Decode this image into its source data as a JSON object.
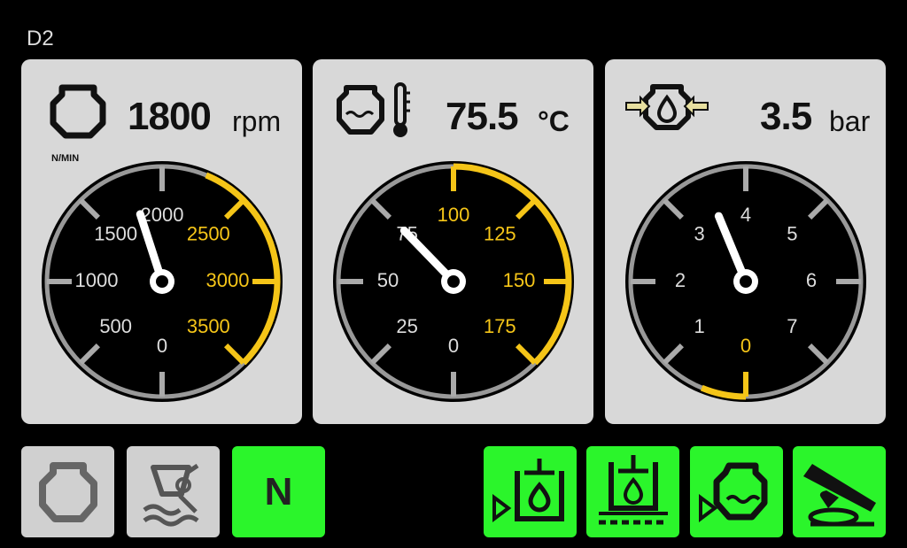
{
  "screen": {
    "label": "D2"
  },
  "colors": {
    "panel_bg": "#d8d8d8",
    "accent": "#f5c518",
    "button_active": "#2bf52b",
    "button_inactive": "#d0d0d0"
  },
  "gauges": [
    {
      "name": "engine-speed",
      "value_text": "1800",
      "unit": "rpm",
      "sublabel": "N/MIN",
      "icon": "engine-icon",
      "value": 1800,
      "min": 0,
      "max": 3500,
      "ticks": [
        "0",
        "500",
        "1000",
        "1500",
        "2000",
        "2500",
        "3000",
        "3500"
      ],
      "warn_from": 2250
    },
    {
      "name": "coolant-temp",
      "value_text": "75.5",
      "unit": "°C",
      "icon": "coolant-temperature-icon",
      "value": 75.5,
      "min": 0,
      "max": 175,
      "ticks": [
        "0",
        "25",
        "50",
        "75",
        "100",
        "125",
        "150",
        "175"
      ],
      "warn_from": 100
    },
    {
      "name": "oil-pressure",
      "value_text": "3.5",
      "unit": "bar",
      "icon": "oil-pressure-icon",
      "value": 3.5,
      "min": 0,
      "max": 7,
      "ticks": [
        "0",
        "1",
        "2",
        "3",
        "4",
        "5",
        "6",
        "7"
      ],
      "warn_to": 0.5
    }
  ],
  "buttons": [
    {
      "name": "engine-button",
      "icon": "engine-icon",
      "state": "inactive"
    },
    {
      "name": "wading-button",
      "icon": "wading-icon",
      "state": "inactive"
    },
    {
      "name": "neutral-button",
      "label": "N",
      "state": "active"
    },
    {
      "name": "fuel-tank-button",
      "icon": "fuel-tank-icon",
      "state": "active"
    },
    {
      "name": "oil-tank-button",
      "icon": "oil-tank-icon",
      "state": "active"
    },
    {
      "name": "engine-coolant-button",
      "icon": "engine-coolant-icon",
      "state": "active"
    },
    {
      "name": "pedal-button",
      "icon": "pedal-icon",
      "state": "active"
    }
  ]
}
